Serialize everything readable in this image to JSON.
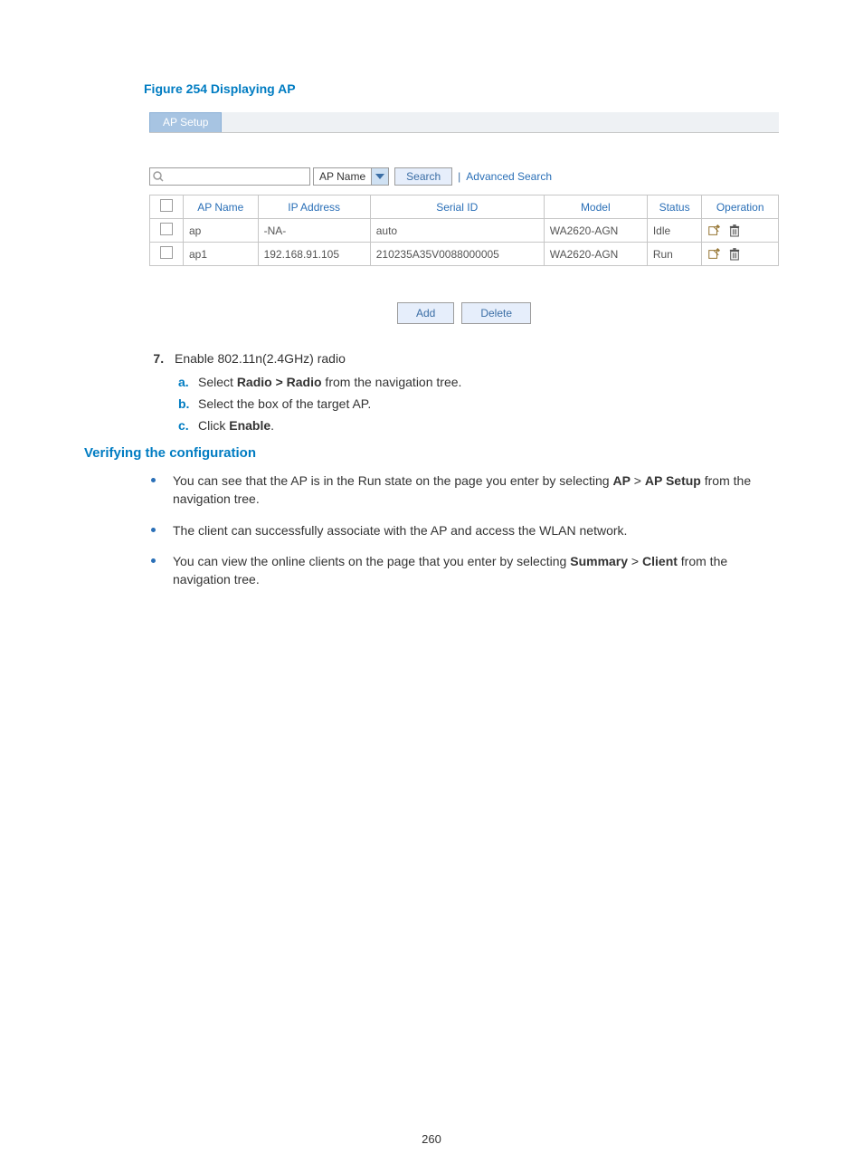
{
  "figure_caption": "Figure 254 Displaying AP",
  "tab_label": "AP Setup",
  "search": {
    "dropdown_value": "AP Name",
    "search_btn": "Search",
    "advanced_link": "Advanced Search"
  },
  "table": {
    "headers": [
      "AP Name",
      "IP Address",
      "Serial ID",
      "Model",
      "Status",
      "Operation"
    ],
    "rows": [
      {
        "ap_name": "ap",
        "ip": "-NA-",
        "serial": "auto",
        "model": "WA2620-AGN",
        "status": "Idle"
      },
      {
        "ap_name": "ap1",
        "ip": "192.168.91.105",
        "serial": "210235A35V0088000005",
        "model": "WA2620-AGN",
        "status": "Run"
      }
    ]
  },
  "buttons": {
    "add": "Add",
    "delete": "Delete"
  },
  "step7": {
    "number": "7.",
    "title": "Enable 802.11n(2.4GHz) radio",
    "a_lbl": "a.",
    "a_pre": "Select ",
    "a_bold": "Radio > Radio",
    "a_post": " from the navigation tree.",
    "b_lbl": "b.",
    "b_text": "Select the box of the target AP.",
    "c_lbl": "c.",
    "c_pre": "Click ",
    "c_bold": "Enable",
    "c_post": "."
  },
  "section_heading": "Verifying the configuration",
  "bullet1_pre": "You can see that the AP is in the Run state on the page you enter by selecting ",
  "bullet1_b1": "AP",
  "bullet1_mid": " > ",
  "bullet1_b2": "AP Setup",
  "bullet1_post": " from the navigation tree.",
  "bullet2": "The client can successfully associate with the AP and access the WLAN network.",
  "bullet3_pre": "You can view the online clients on the page that you enter by selecting ",
  "bullet3_b1": "Summary",
  "bullet3_mid": " > ",
  "bullet3_b2": "Client",
  "bullet3_post": " from the navigation tree.",
  "page_number": "260"
}
